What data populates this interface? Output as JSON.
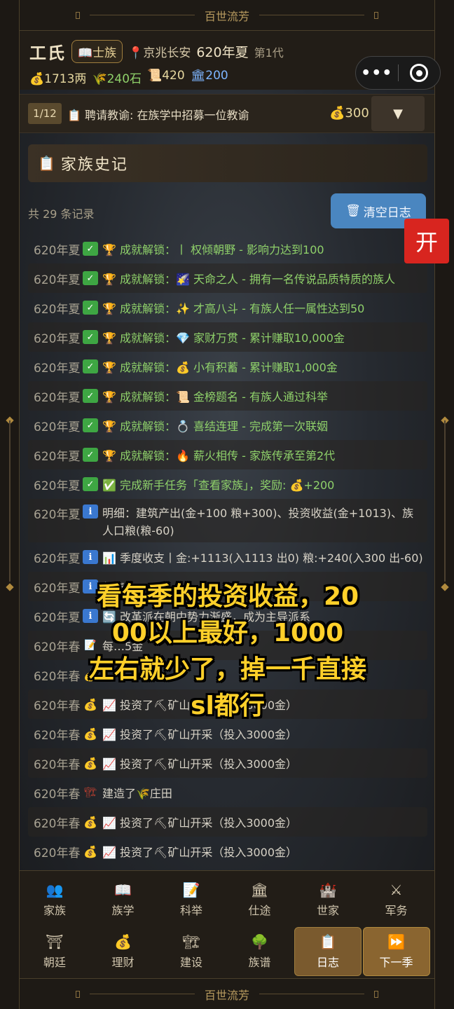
{
  "game_title": "百世流芳",
  "header": {
    "family_name": "工氏",
    "rank": "士族",
    "location": "京兆长安",
    "season": "620年夏",
    "generation": "第1代",
    "resources": {
      "gold": "1713两",
      "grain": "240石",
      "scrolls": "420",
      "prestige": "200"
    }
  },
  "mini_capsule": {
    "more": "•••"
  },
  "task": {
    "progress": "1/12",
    "text": "聘请教谕: 在族学中招募一位教谕",
    "cost": "300",
    "toggle": "▼"
  },
  "panel": {
    "title": "家族史记",
    "record_count": "共 29 条记录",
    "clear_button": "清空日志"
  },
  "logs": [
    {
      "date": "620年夏",
      "icon": "check",
      "text": "🏆 成就解锁：丨 权倾朝野 - 影响力达到100",
      "kind": "ach"
    },
    {
      "date": "620年夏",
      "icon": "check",
      "text": "🏆 成就解锁：🌠 天命之人 - 拥有一名传说品质特质的族人",
      "kind": "ach"
    },
    {
      "date": "620年夏",
      "icon": "check",
      "text": "🏆 成就解锁：✨ 才高八斗 - 有族人任一属性达到50",
      "kind": "ach"
    },
    {
      "date": "620年夏",
      "icon": "check",
      "text": "🏆 成就解锁：💎 家财万贯 - 累计赚取10,000金",
      "kind": "ach"
    },
    {
      "date": "620年夏",
      "icon": "check",
      "text": "🏆 成就解锁：💰 小有积蓄 - 累计赚取1,000金",
      "kind": "ach"
    },
    {
      "date": "620年夏",
      "icon": "check",
      "text": "🏆 成就解锁：📜 金榜题名 - 有族人通过科举",
      "kind": "ach"
    },
    {
      "date": "620年夏",
      "icon": "check",
      "text": "🏆 成就解锁：💍 喜结连理 - 完成第一次联姻",
      "kind": "ach"
    },
    {
      "date": "620年夏",
      "icon": "check",
      "text": "🏆 成就解锁：🔥 薪火相传 - 家族传承至第2代",
      "kind": "ach"
    },
    {
      "date": "620年夏",
      "icon": "check",
      "text": "✅ 完成新手任务「查看家族」，奖励: 💰+200",
      "kind": "ach"
    },
    {
      "date": "620年夏",
      "icon": "info",
      "text": "明细：建筑产出(金+100 粮+300)、投资收益(金+1013)、族人口粮(粮-60)",
      "kind": "info",
      "tall": true
    },
    {
      "date": "620年夏",
      "icon": "info",
      "text": "📊 季度收支丨金:+1113(入1113 出0) 粮:+240(入300 出-60)",
      "kind": "info"
    },
    {
      "date": "620年夏",
      "icon": "info",
      "text": "领俸",
      "kind": "info"
    },
    {
      "date": "620年夏",
      "icon": "info",
      "text": "🔄 改革派在朝中势力渐盛，成为主导派系",
      "kind": "info"
    },
    {
      "date": "620年春",
      "icon": "memo",
      "text": "每…5金",
      "kind": "info"
    },
    {
      "date": "620年春",
      "icon": "bag",
      "text": "",
      "kind": "info"
    },
    {
      "date": "620年春",
      "icon": "bag",
      "text": "📈 投资了⛏矿山开采（投入3000金）",
      "kind": "info"
    },
    {
      "date": "620年春",
      "icon": "bag",
      "text": "📈 投资了⛏矿山开采（投入3000金）",
      "kind": "info"
    },
    {
      "date": "620年春",
      "icon": "bag",
      "text": "📈 投资了⛏矿山开采（投入3000金）",
      "kind": "info"
    },
    {
      "date": "620年春",
      "icon": "build",
      "text": "建造了🌾庄田",
      "kind": "info"
    },
    {
      "date": "620年春",
      "icon": "bag",
      "text": "📈 投资了⛏矿山开采（投入3000金）",
      "kind": "info"
    },
    {
      "date": "620年春",
      "icon": "bag",
      "text": "📈 投资了⛏矿山开采（投入3000金）",
      "kind": "info"
    }
  ],
  "overlay": {
    "lines": [
      "看每季的投资收益，20",
      "00以上最好，1000",
      "左右就少了，掉一千直接",
      "sl都行"
    ]
  },
  "float_button": "开",
  "nav": [
    {
      "label": "家族",
      "icon": "people-icon",
      "glyph": "👥"
    },
    {
      "label": "族学",
      "icon": "book-icon",
      "glyph": "📖"
    },
    {
      "label": "科举",
      "icon": "memo-icon",
      "glyph": "📝"
    },
    {
      "label": "仕途",
      "icon": "pillar-icon",
      "glyph": "🏛"
    },
    {
      "label": "世家",
      "icon": "castle-icon",
      "glyph": "🏰"
    },
    {
      "label": "军务",
      "icon": "swords-icon",
      "glyph": "⚔"
    },
    {
      "label": "朝廷",
      "icon": "court-icon",
      "glyph": "⛩"
    },
    {
      "label": "理财",
      "icon": "moneybag-icon",
      "glyph": "💰"
    },
    {
      "label": "建设",
      "icon": "crane-icon",
      "glyph": "🏗"
    },
    {
      "label": "族谱",
      "icon": "tree-icon",
      "glyph": "🌳"
    },
    {
      "label": "日志",
      "icon": "log-icon",
      "glyph": "📋",
      "active": true
    },
    {
      "label": "下一季",
      "icon": "fast-forward-icon",
      "glyph": "⏩",
      "next": true
    }
  ]
}
